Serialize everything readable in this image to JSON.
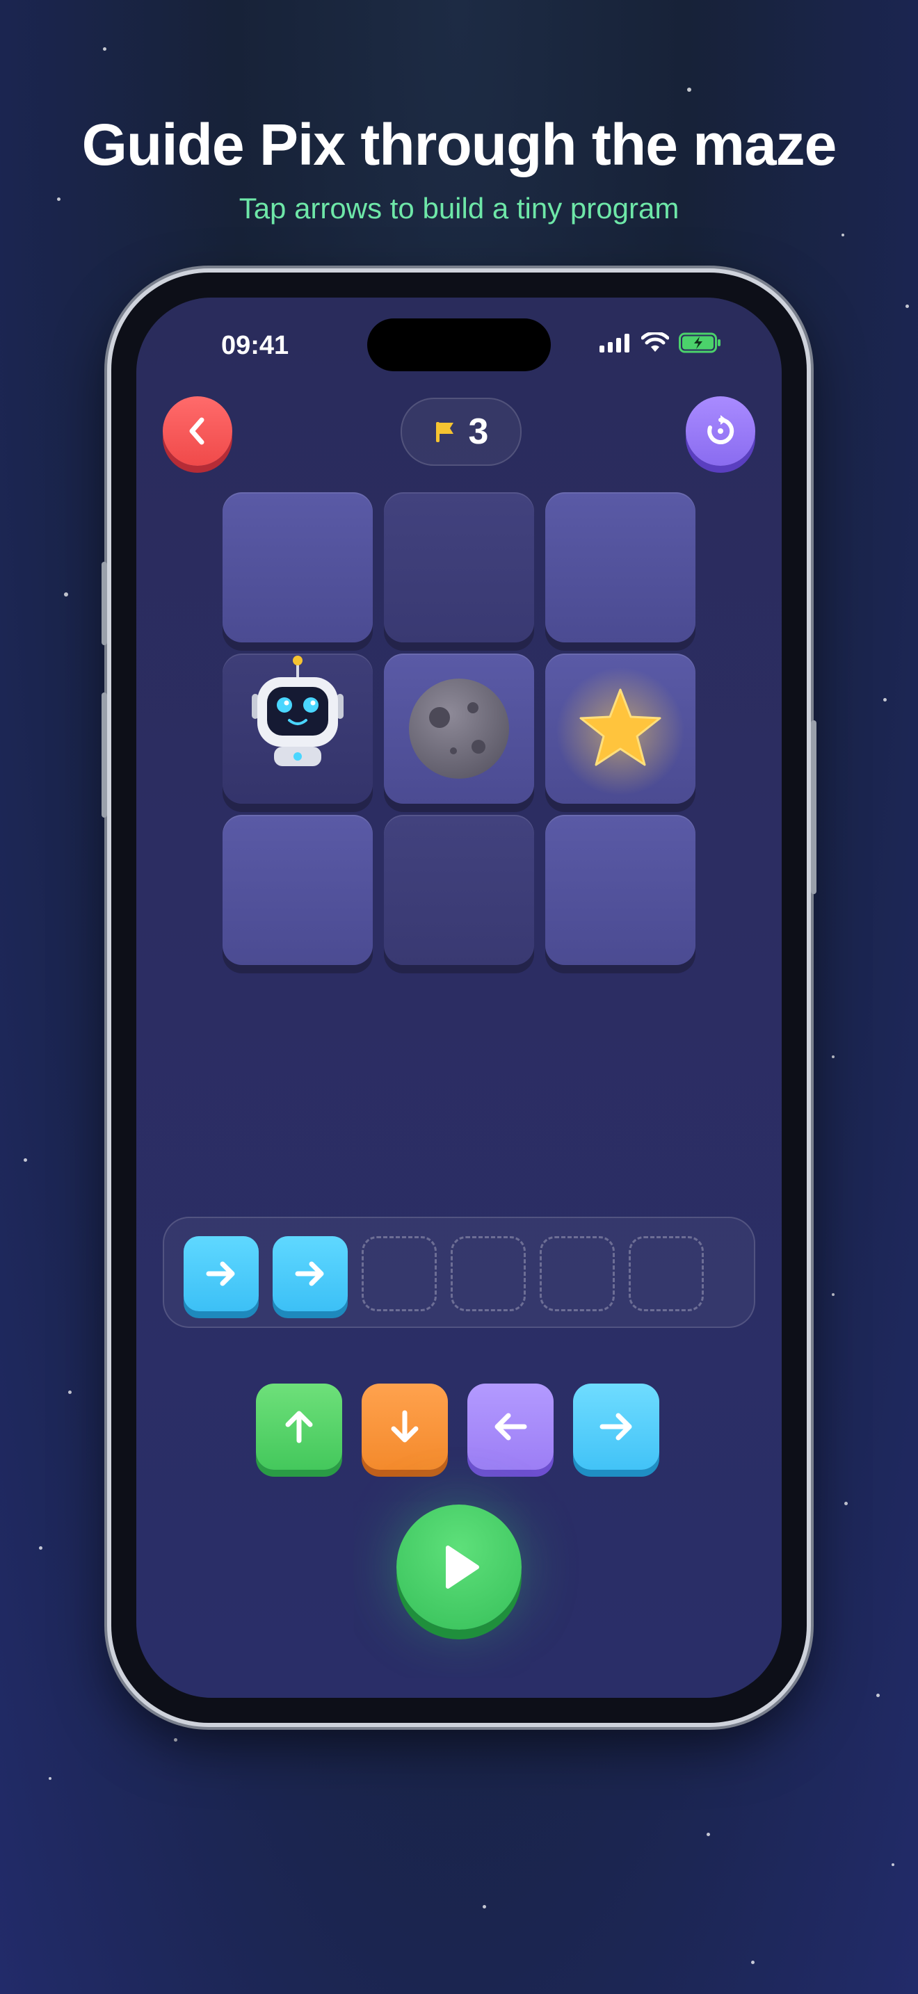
{
  "promo": {
    "headline": "Guide Pix through the maze",
    "subheadline": "Tap arrows to build a tiny program"
  },
  "status_bar": {
    "time": "09:41",
    "icons": [
      "signal-icon",
      "wifi-icon",
      "battery-charging-icon"
    ]
  },
  "header": {
    "back_icon": "chevron-left-icon",
    "flag_icon": "flag-icon",
    "flag_count": "3",
    "reset_icon": "restart-icon"
  },
  "grid": {
    "rows": 3,
    "cols": 3,
    "cells": [
      {
        "row": 0,
        "col": 0,
        "content": "empty"
      },
      {
        "row": 0,
        "col": 1,
        "content": "empty"
      },
      {
        "row": 0,
        "col": 2,
        "content": "empty"
      },
      {
        "row": 1,
        "col": 0,
        "content": "robot"
      },
      {
        "row": 1,
        "col": 1,
        "content": "moon-rock"
      },
      {
        "row": 1,
        "col": 2,
        "content": "star"
      },
      {
        "row": 2,
        "col": 0,
        "content": "empty"
      },
      {
        "row": 2,
        "col": 1,
        "content": "empty"
      },
      {
        "row": 2,
        "col": 2,
        "content": "empty"
      }
    ]
  },
  "program": {
    "slots": [
      "right",
      "right",
      "",
      "",
      "",
      ""
    ]
  },
  "controls": {
    "arrows": [
      "up",
      "down",
      "left",
      "right"
    ],
    "play_icon": "play-icon"
  },
  "colors": {
    "up": "#44c85c",
    "down": "#f48a2c",
    "left": "#9c7ef5",
    "right": "#42c3f7",
    "back": "#f04a4a",
    "reset": "#8a6cf0",
    "play": "#37c05a",
    "subheadline": "#6ee7a8"
  }
}
